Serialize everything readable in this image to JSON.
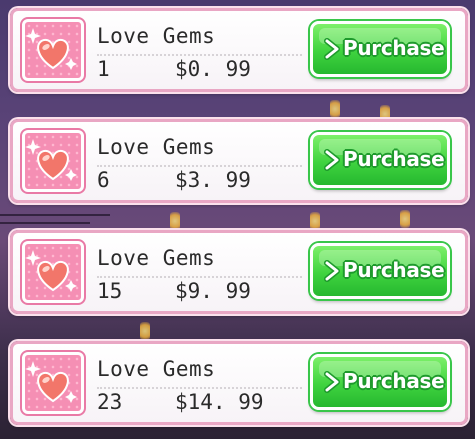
{
  "colors": {
    "row_border": "#e9a7c4",
    "tile_pink": "#f58fb4",
    "heart": "#f2766a",
    "button_green": "#3fd33f"
  },
  "products": [
    {
      "title": "Love Gems",
      "quantity": "1",
      "price": "$0. 99",
      "button_label": "Purchase",
      "icon": "heart-gem-icon"
    },
    {
      "title": "Love Gems",
      "quantity": "6",
      "price": "$3. 99",
      "button_label": "Purchase",
      "icon": "heart-gem-icon"
    },
    {
      "title": "Love Gems",
      "quantity": "15",
      "price": "$9. 99",
      "button_label": "Purchase",
      "icon": "heart-gem-icon"
    },
    {
      "title": "Love Gems",
      "quantity": "23",
      "price": "$14. 99",
      "button_label": "Purchase",
      "icon": "heart-gem-icon"
    }
  ]
}
